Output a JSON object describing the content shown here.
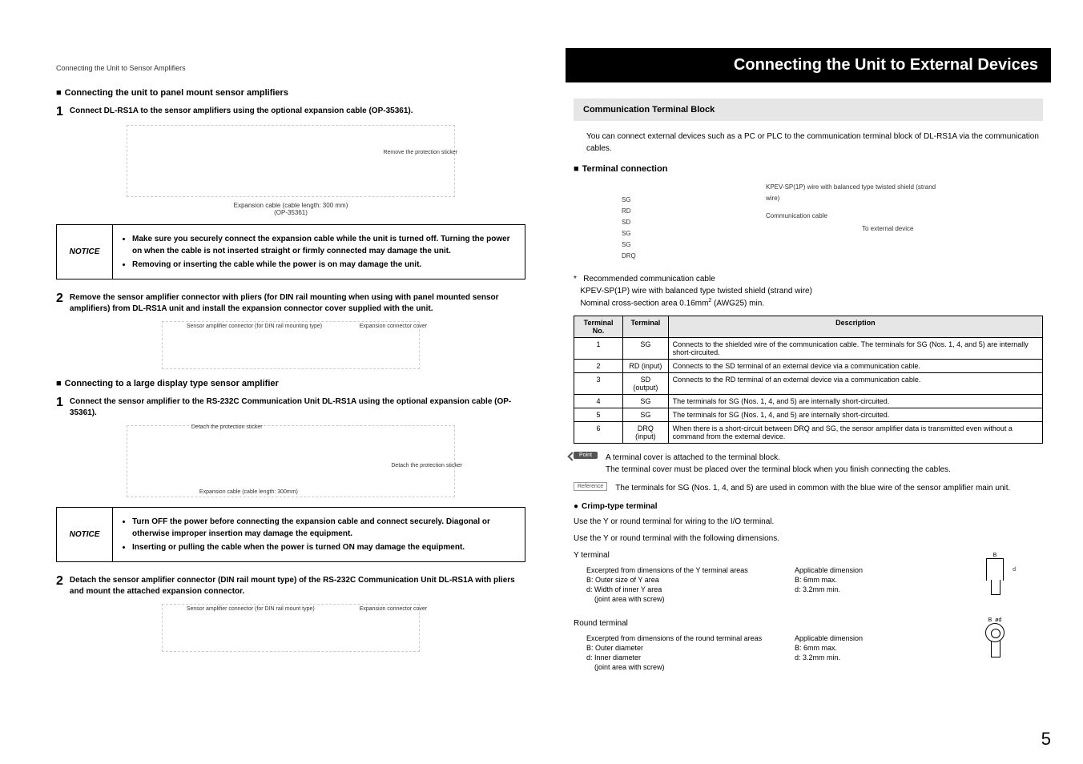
{
  "crumb": "Connecting the Unit to Sensor Amplifiers",
  "main_title": "Connecting the Unit to External Devices",
  "left": {
    "h1": "Connecting the unit to panel mount sensor amplifiers",
    "s1": {
      "num": "1",
      "text": "Connect DL-RS1A to the sensor amplifiers using the optional expansion cable (OP-35361).",
      "diag_labels": {
        "remove": "Remove the protection sticker",
        "cable": "Expansion cable (cable length: 300 mm)",
        "part": "(OP-35361)"
      }
    },
    "notice1": {
      "label": "NOTICE",
      "b1": "Make sure you securely connect the expansion cable while the unit is turned off. Turning the power on when the cable is not inserted straight or firmly connected may damage the unit.",
      "b2": "Removing or inserting the cable while the power is on may damage the unit."
    },
    "s2": {
      "num": "2",
      "text": "Remove the sensor amplifier connector with pliers (for DIN rail mounting when using with panel mounted sensor amplifiers) from DL-RS1A unit and install the expansion connector cover supplied with the unit.",
      "diag_labels": {
        "conn": "Sensor amplifier connector (for DIN rail mounting type)",
        "cover": "Expansion connector cover"
      }
    },
    "h2": "Connecting to a large display type sensor amplifier",
    "s3": {
      "num": "1",
      "text": "Connect the sensor amplifier to the RS-232C Communication Unit DL-RS1A using the optional expansion cable (OP-35361).",
      "diag_labels": {
        "detach1": "Detach the protection sticker",
        "detach2": "Detach the protection sticker",
        "cable": "Expansion cable (cable length: 300mm)"
      }
    },
    "notice2": {
      "label": "NOTICE",
      "b1": "Turn OFF the power before connecting the expansion cable and connect securely. Diagonal or otherwise improper insertion may damage the equipment.",
      "b2": "Inserting or pulling the cable when the power is turned ON may damage the equipment."
    },
    "s4": {
      "num": "2",
      "text": "Detach the sensor amplifier connector (DIN rail mount type) of the RS-232C Communication Unit DL-RS1A with pliers and mount the attached expansion connector.",
      "diag_labels": {
        "conn": "Sensor amplifier connector (for DIN rail mount type)",
        "cover": "Expansion connector cover"
      }
    }
  },
  "right": {
    "section": "Communication Terminal Block",
    "intro": "You can connect external devices such as a PC or PLC to the communication terminal block of DL-RS1A via the communication cables.",
    "h_term": "Terminal connection",
    "diag": {
      "sg": "SG",
      "rd": "RD",
      "sd": "SD",
      "sg2": "SG",
      "sg3": "SG",
      "drq": "DRQ",
      "wire": "KPEV-SP(1P) wire with balanced type twisted shield (strand wire)",
      "comm": "Communication cable",
      "ext": "To external device"
    },
    "footnote": {
      "star": "*",
      "l1": "Recommended communication cable",
      "l2": "KPEV-SP(1P) wire with balanced type twisted shield (strand wire)",
      "l3a": "Nominal cross-section area 0.16mm",
      "l3b": " (AWG25) min."
    },
    "table": {
      "h1": "Terminal No.",
      "h2": "Terminal",
      "h3": "Description",
      "rows": [
        {
          "no": "1",
          "t": "SG",
          "d": "Connects to the shielded wire of the communication cable.\nThe terminals for SG (Nos. 1, 4, and 5) are internally short-circuited."
        },
        {
          "no": "2",
          "t": "RD (input)",
          "d": "Connects to the SD terminal of an external device via a communication cable."
        },
        {
          "no": "3",
          "t": "SD (output)",
          "d": "Connects to the RD terminal of an external device via a communication cable."
        },
        {
          "no": "4",
          "t": "SG",
          "d": "The terminals for SG (Nos. 1, 4, and 5) are internally short-circuited."
        },
        {
          "no": "5",
          "t": "SG",
          "d": "The terminals for SG (Nos. 1, 4, and 5) are internally short-circuited."
        },
        {
          "no": "6",
          "t": "DRQ (input)",
          "d": "When there is a short-circuit between DRQ and SG, the sensor amplifier data is transmitted even without a command from the external device."
        }
      ]
    },
    "point": {
      "tag": "Point",
      "l1": "A terminal cover is attached to the terminal block.",
      "l2": "The terminal cover must be placed over the terminal block when you finish connecting the cables."
    },
    "reference": {
      "tag": "Reference",
      "text": "The terminals for SG (Nos. 1, 4, and 5) are used in common with the blue wire of the sensor amplifier main unit."
    },
    "crimp": {
      "head": "Crimp-type terminal",
      "l1": "Use the Y or round terminal for wiring to the I/O terminal.",
      "l2": "Use the Y or round terminal with the following dimensions."
    },
    "y": {
      "title": "Y terminal",
      "ex": "Excerpted from dimensions of the Y terminal areas",
      "ap": "Applicable dimension",
      "b_lbl": "B: Outer size of Y area",
      "b_val": "B: 6mm max.",
      "d_lbl": "d: Width of inner Y area",
      "d_val": "d: 3.2mm min.",
      "joint": "(joint area with screw)",
      "B": "B",
      "d": "d"
    },
    "round": {
      "title": "Round terminal",
      "ex": "Excerpted from dimensions of the round terminal areas",
      "ap": "Applicable dimension",
      "b_lbl": "B: Outer diameter",
      "b_val": "B: 6mm max.",
      "d_lbl": "d: Inner diameter",
      "d_val": "d: 3.2mm min.",
      "joint": "(joint area with screw)",
      "B": "B",
      "d": "ød"
    }
  },
  "page": "5"
}
